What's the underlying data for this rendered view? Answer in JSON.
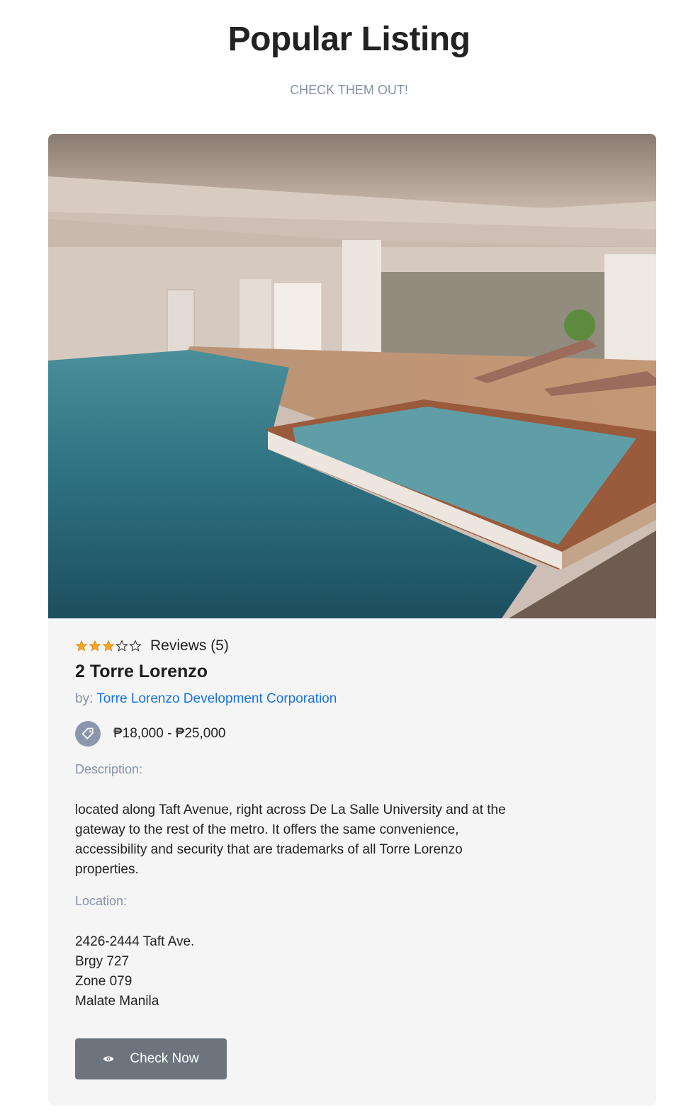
{
  "section": {
    "title": "Popular Listing",
    "subtitle": "CHECK THEM OUT!"
  },
  "listing": {
    "rating": 3,
    "rating_max": 5,
    "reviews_label": "Reviews (5)",
    "name": "2 Torre Lorenzo",
    "by_prefix": "by:",
    "developer": "Torre Lorenzo Development Corporation",
    "price_range": "₱18,000 - ₱25,000",
    "description_label": "Description:",
    "description": "located along Taft Avenue, right across De La Salle University and at the gateway to the rest of the metro. It offers the same convenience, accessibility and security that are trademarks of all Torre Lorenzo properties.",
    "location_label": "Location:",
    "address_lines": [
      "2426-2444 Taft Ave.",
      "Brgy 727",
      "Zone 079",
      "Malate Manila"
    ],
    "button_label": "Check Now",
    "button_icon": "eye-icon",
    "price_icon": "price-tag-icon",
    "star_color": "#f5a623",
    "link_color": "#1672e8"
  }
}
